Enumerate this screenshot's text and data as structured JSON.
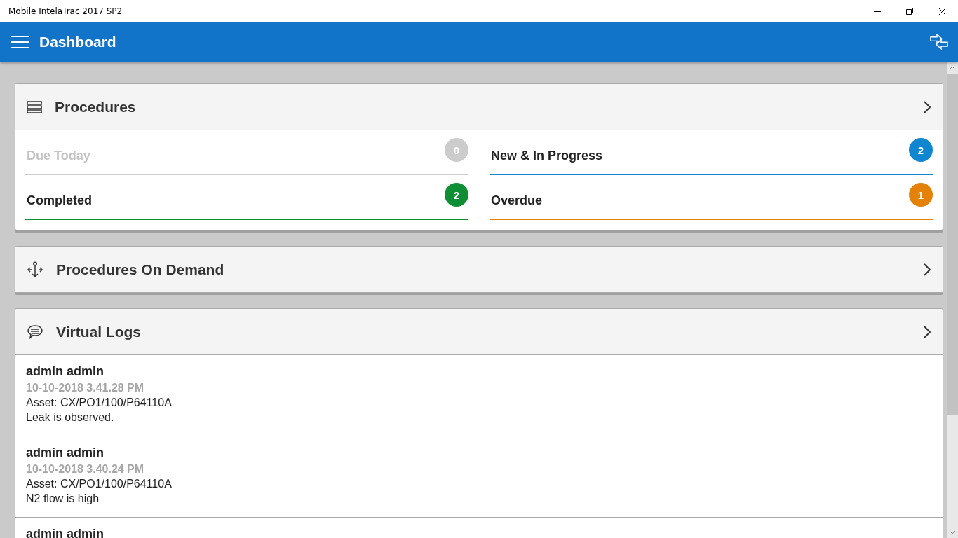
{
  "window": {
    "title": "Mobile IntelaTrac 2017 SP2"
  },
  "app_bar": {
    "title": "Dashboard"
  },
  "procedures": {
    "title": "Procedures",
    "tiles": [
      {
        "label": "Due Today",
        "count": "0",
        "color": "#cccccc",
        "disabled": true
      },
      {
        "label": "New & In Progress",
        "count": "2",
        "color": "#1085d0",
        "disabled": false
      },
      {
        "label": "Completed",
        "count": "2",
        "color": "#0f8f35",
        "disabled": false
      },
      {
        "label": "Overdue",
        "count": "1",
        "color": "#e38207",
        "disabled": false
      }
    ]
  },
  "procedures_on_demand": {
    "title": "Procedures On Demand"
  },
  "virtual_logs": {
    "title": "Virtual Logs",
    "entries": [
      {
        "user": "admin admin",
        "time": "10-10-2018 3.41.28 PM",
        "asset": "Asset: CX/PO1/100/P64110A",
        "note": "Leak is observed."
      },
      {
        "user": "admin admin",
        "time": "10-10-2018 3.40.24 PM",
        "asset": "Asset: CX/PO1/100/P64110A",
        "note": "N2 flow is high"
      },
      {
        "user": "admin admin"
      }
    ]
  }
}
